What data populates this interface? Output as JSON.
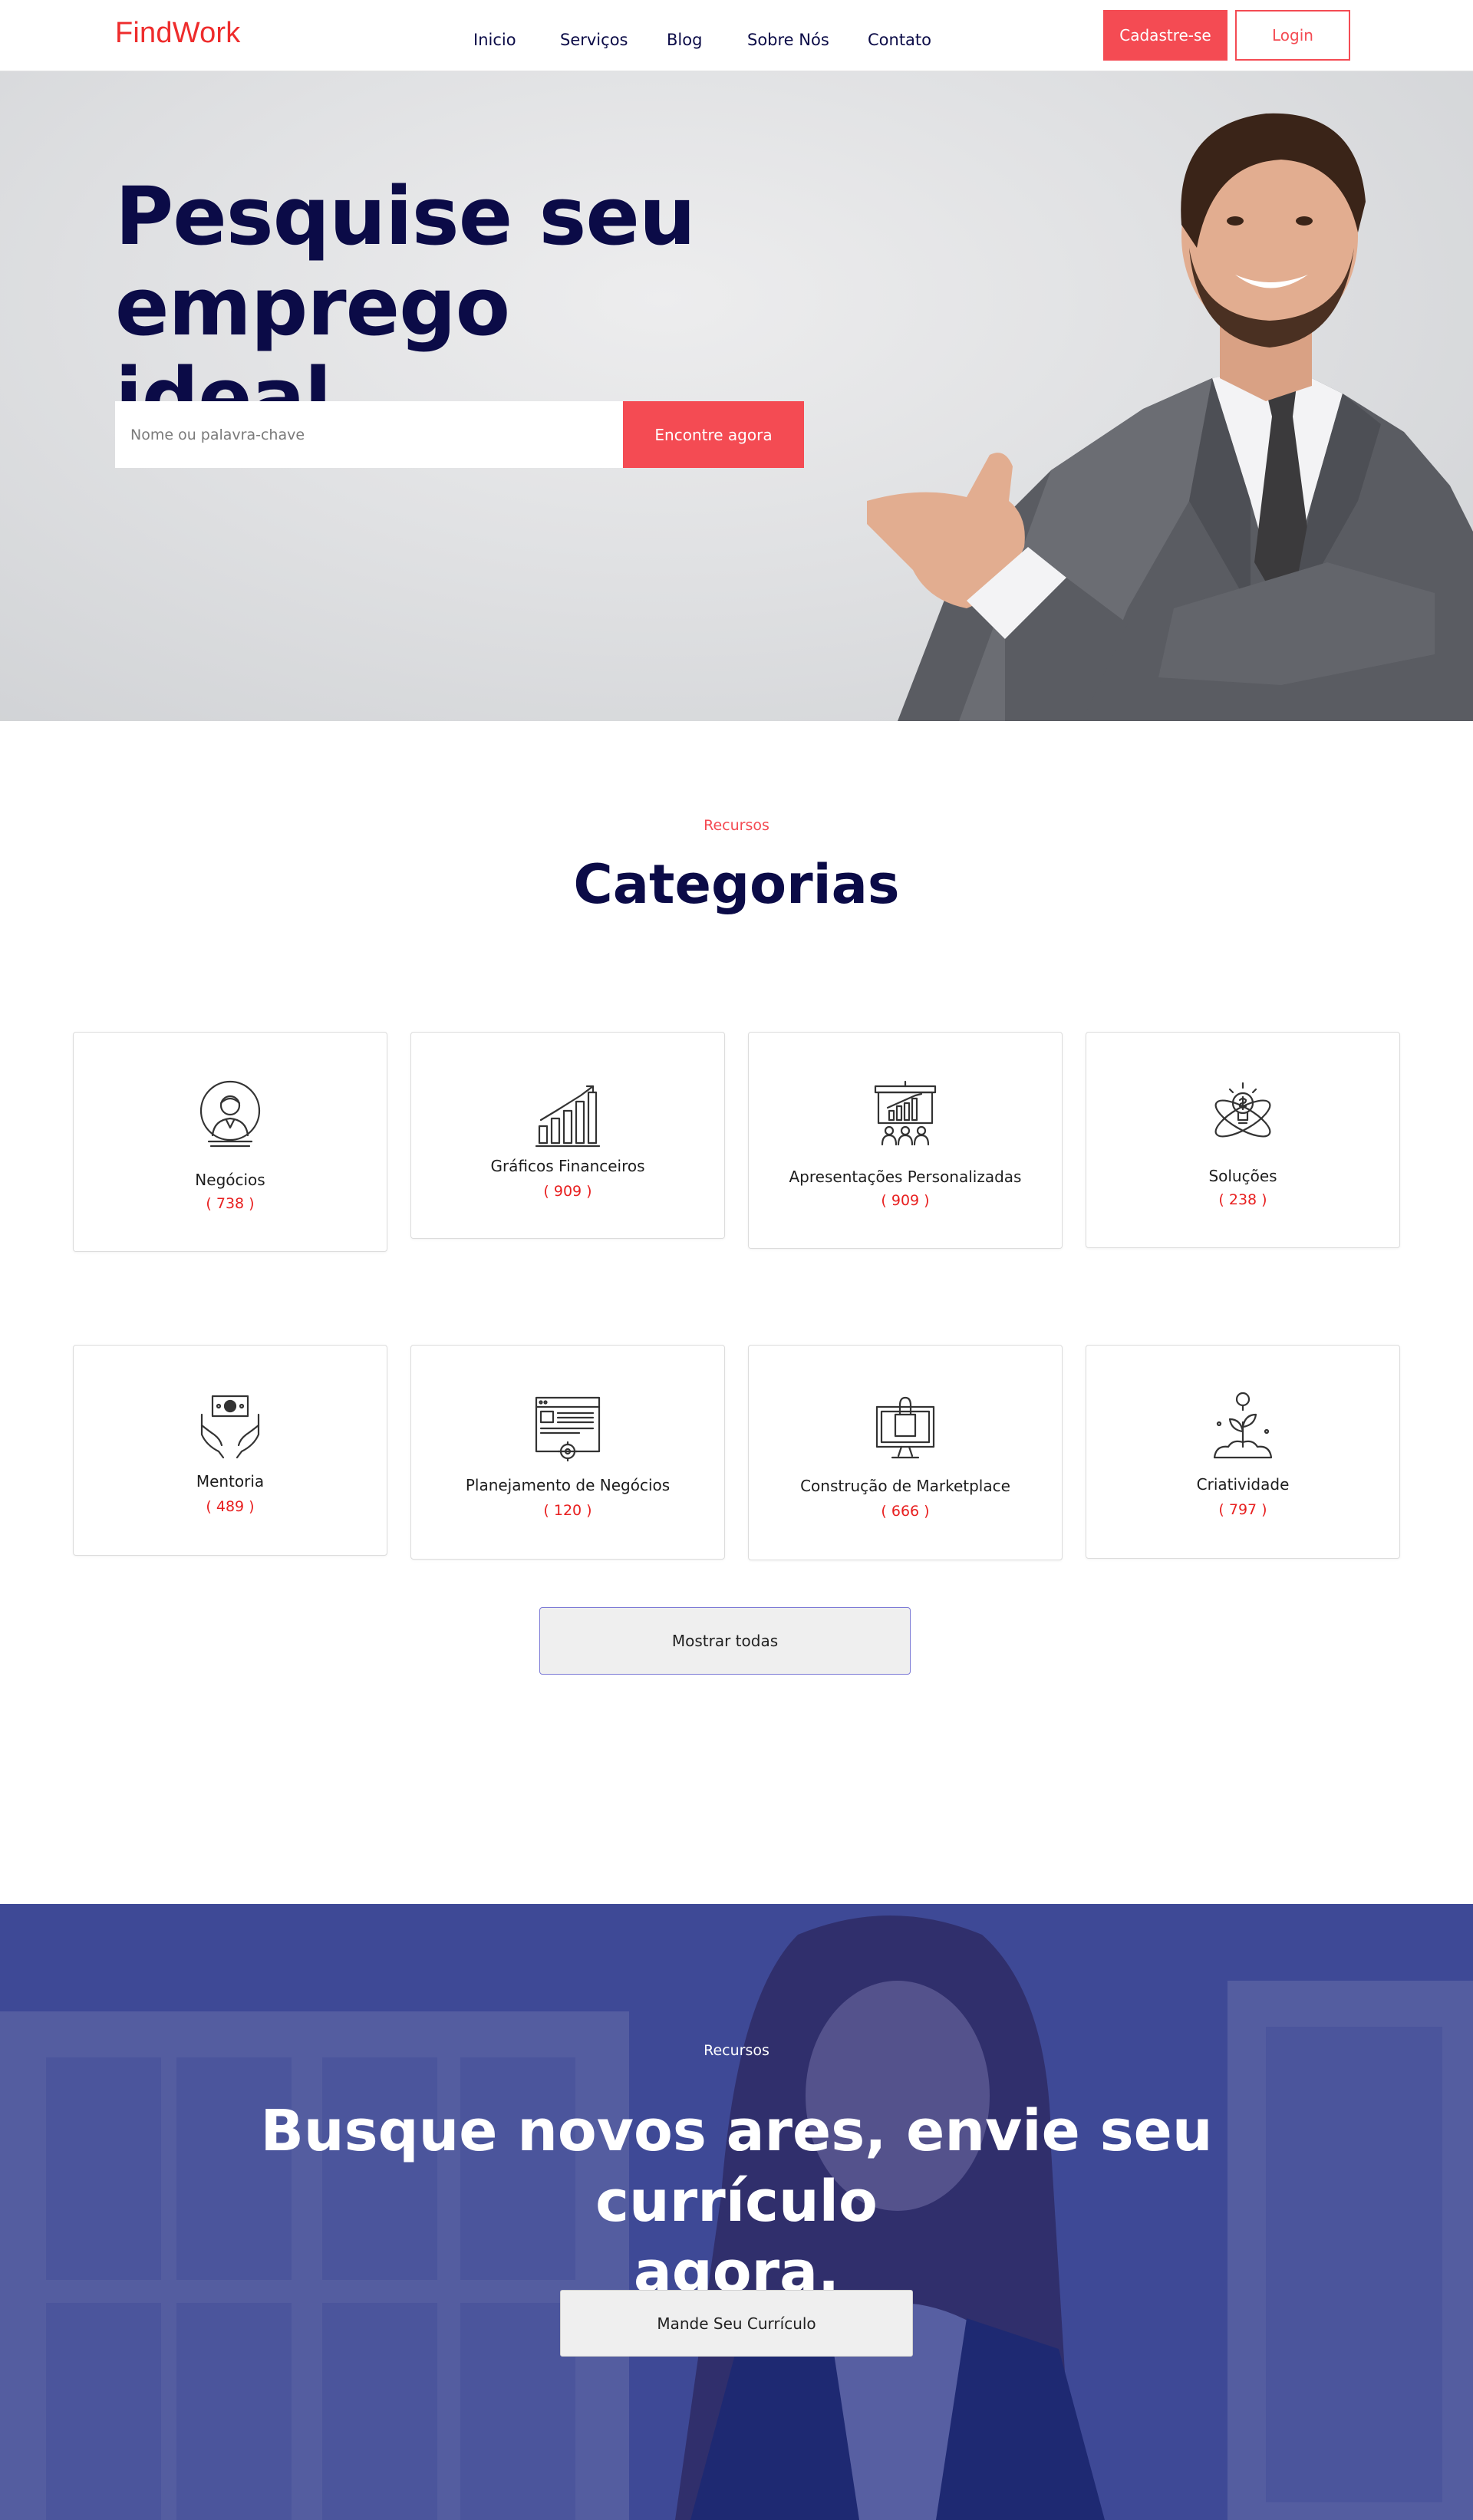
{
  "navbar": {
    "logo": "FindWork",
    "links": [
      "Inicio",
      "Serviços",
      "Blog",
      "Sobre Nós",
      "Contato"
    ],
    "signup_label": "Cadastre-se",
    "login_label": "Login"
  },
  "hero": {
    "title_line1": "Pesquise seu",
    "title_line2": "emprego ideal",
    "search_placeholder": "Nome ou palavra-chave",
    "search_button": "Encontre agora"
  },
  "categories": {
    "kicker": "Recursos",
    "title": "Categorias",
    "items": [
      {
        "label": "Negócios",
        "count": "( 738 )",
        "icon": "businessman-icon"
      },
      {
        "label": "Gráficos Financeiros",
        "count": "( 909 )",
        "icon": "bar-chart-icon"
      },
      {
        "label": "Apresentações Personalizadas",
        "count": "( 909 )",
        "icon": "presentation-icon"
      },
      {
        "label": "Soluções",
        "count": "( 238 )",
        "icon": "lightbulb-atom-icon"
      },
      {
        "label": "Mentoria",
        "count": "( 489 )",
        "icon": "money-hands-icon"
      },
      {
        "label": "Planejamento de Negócios",
        "count": "( 120 )",
        "icon": "browser-gear-icon"
      },
      {
        "label": "Construção de Marketplace",
        "count": "( 666 )",
        "icon": "monitor-bag-icon"
      },
      {
        "label": "Criatividade",
        "count": "( 797 )",
        "icon": "plant-idea-icon"
      }
    ],
    "show_all": "Mostrar todas"
  },
  "cta": {
    "kicker": "Recursos",
    "title_line1": "Busque novos ares, envie seu currículo",
    "title_line2": "agora.",
    "button": "Mande Seu Currículo"
  },
  "colors": {
    "brand": "#ee2c2c",
    "accent": "#f44b53",
    "navy": "#0b0b47",
    "cta_overlay": "#1a2680"
  }
}
